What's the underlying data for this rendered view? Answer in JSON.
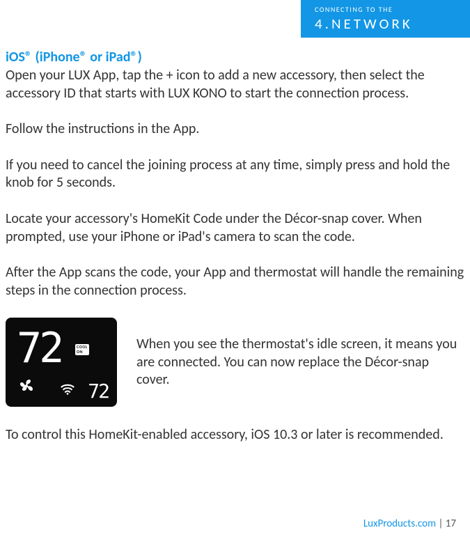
{
  "header": {
    "subtitle": "CONNECTING TO THE",
    "title": "4.NETWORK"
  },
  "section_heading": "iOS® (iPhone® or iPad®)",
  "paragraphs": {
    "p1": "Open your LUX App, tap the + icon to add a new accessory, then select the accessory ID that starts with LUX KONO to start the connection process.",
    "p2": "Follow the instructions in the App.",
    "p3": "If you need to cancel the joining process at any time, simply press and hold the knob for 5 seconds.",
    "p4": "Locate your accessory's HomeKit Code under the Décor-snap cover. When prompted, use your iPhone or iPad's camera to scan the code.",
    "p5": "After the App scans the code, your App and thermostat will handle the remaining steps in the connection process.",
    "p6": "To control this HomeKit-enabled accessory, iOS 10.3 or later is recommended."
  },
  "thermostat": {
    "big_temp": "72",
    "small_temp": "72",
    "mode_line1": "COOL",
    "mode_line2": "ON",
    "idle_text": "When you see the thermostat's idle screen, it means you are connected. You can now replace the Décor-snap cover."
  },
  "footer": {
    "link": "LuxProducts.com",
    "separator": "  |  ",
    "page": "17"
  }
}
